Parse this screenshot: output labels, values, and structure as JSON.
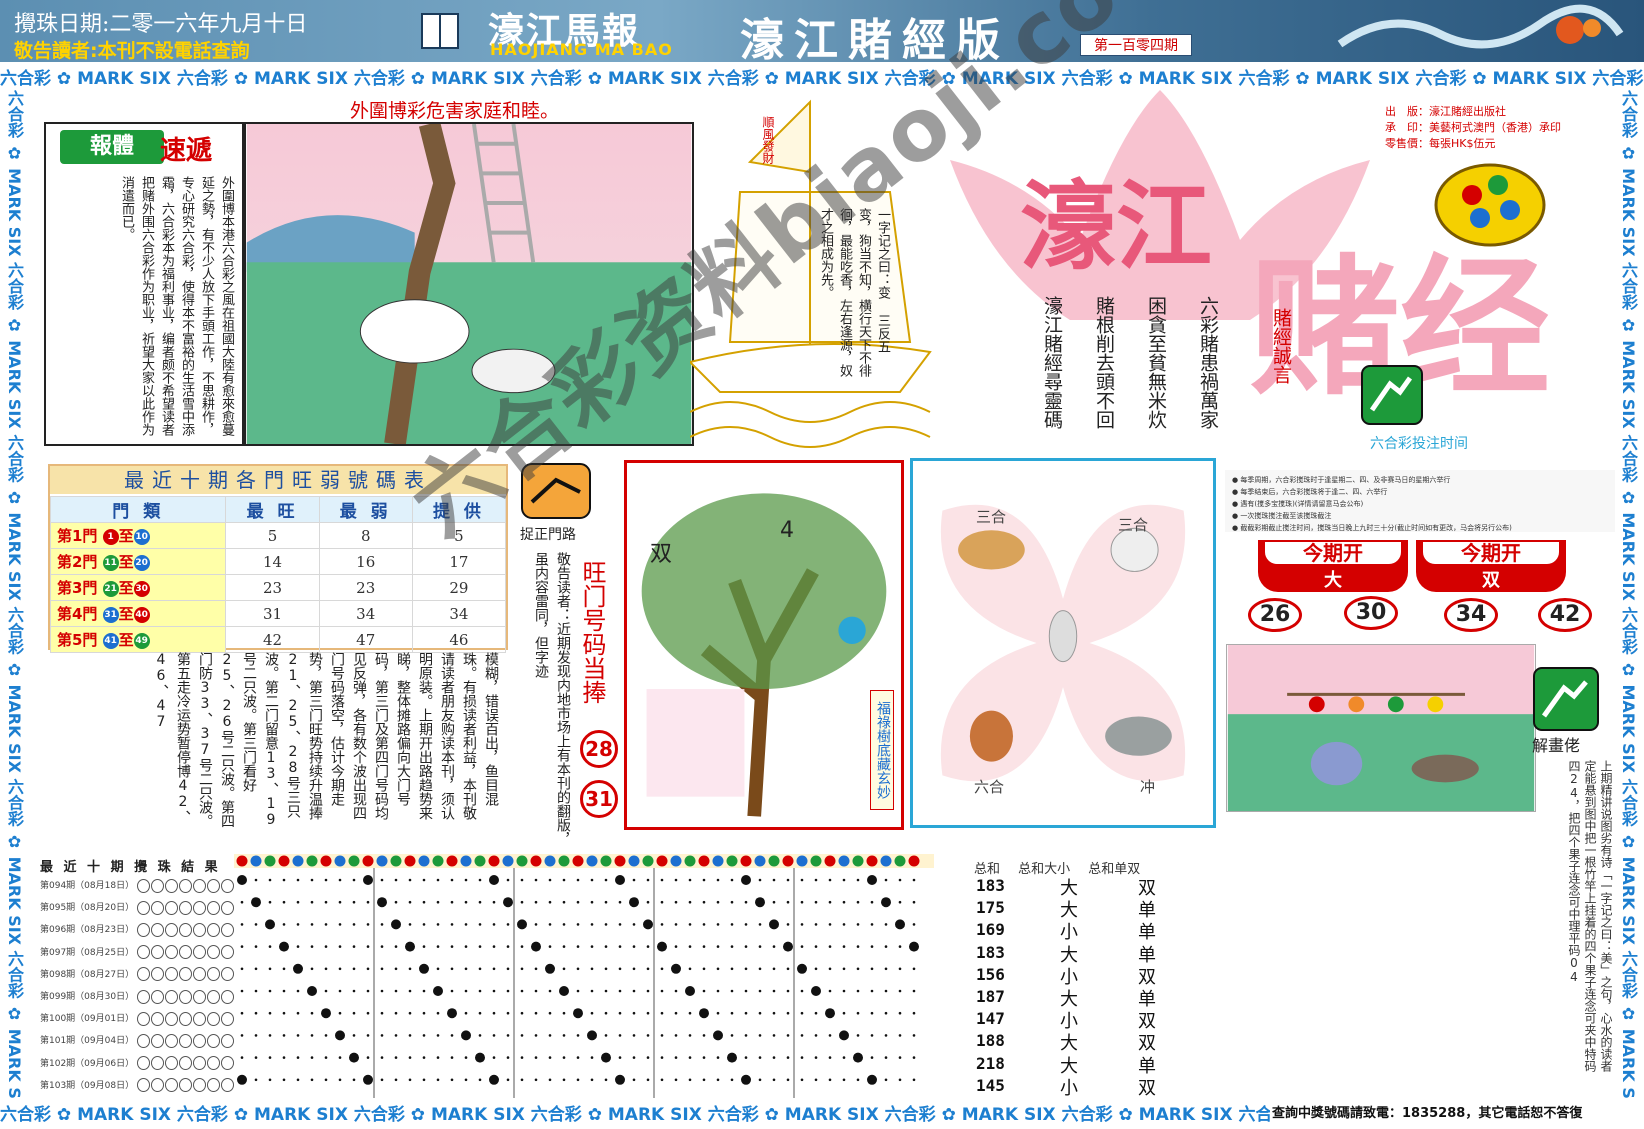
{
  "header": {
    "date": "攪珠日期:二零一六年九月十日",
    "notice": "敬告讀者:本刊不設電話查詢",
    "logo_cn": "濠江馬報",
    "logo_en": "HAOJIANG MA BAO",
    "edition": "濠江賭經版",
    "issue": "第一百零四期"
  },
  "border_text": "六合彩 ✿ MARK SIX 六合彩 ✿ MARK SIX 六合彩 ✿ MARK SIX 六合彩 ✿ MARK SIX 六合彩 ✿ MARK SIX 六合彩 ✿ MARK SIX 六合彩 ✿ MARK SIX 六合彩 ✿ MARK SIX 六合彩 ✿ MARK SIX 六合彩 ✿ MARK SIX",
  "headline": "外圍博彩危害家庭和睦。",
  "article": {
    "tag": "報體",
    "tag2": "速遞",
    "text": "外圍博本港六合彩之風在祖國大陸有愈來愈蔓延之勢，有不少人放下手頭工作，不思耕作，专心研究六合彩，使得本不富裕的生活雪中添霜，六合彩本为福利事业，编者颇不希望读者把赌外围六合彩作为职业，祈望大家以此作为消遣而已。"
  },
  "ship": {
    "flag": "順風發財",
    "text": "一字记之曰：变 三反五变，狗当不知，横行天下不徘徊，最能吃香，左右逢源，奴才之相成为先。"
  },
  "title_block": {
    "big1": "濠江",
    "big2": "赌经",
    "publisher": "出　版：濠江賭經出版社",
    "printer": "承　印：美藝柯式澳門（香港）承印",
    "price": "零售價：每張HK$伍元",
    "slogans": [
      "六彩賭患禍萬家",
      "困貪至貧無米炊",
      "賭根削去頭不回",
      "濠江賭經尋靈碼"
    ],
    "motto": "賭經誠言",
    "bet_time_title": "六合彩投注时间"
  },
  "stats": {
    "title": "最近十期各門旺弱號碼表",
    "headers": [
      "門 類",
      "最 旺",
      "最 弱",
      "提 供"
    ],
    "rows": [
      {
        "door": "第1門",
        "from": "1",
        "to": "10",
        "hot": "5",
        "cold": "8",
        "tip": "5",
        "c1": "#d40000",
        "c2": "#1d6fd0"
      },
      {
        "door": "第2門",
        "from": "11",
        "to": "20",
        "hot": "14",
        "cold": "16",
        "tip": "17",
        "c1": "#1d9a3a",
        "c2": "#1d6fd0"
      },
      {
        "door": "第3門",
        "from": "21",
        "to": "30",
        "hot": "23",
        "cold": "23",
        "tip": "29",
        "c1": "#1d9a3a",
        "c2": "#d40000"
      },
      {
        "door": "第4門",
        "from": "31",
        "to": "40",
        "hot": "31",
        "cold": "34",
        "tip": "34",
        "c1": "#1d6fd0",
        "c2": "#d40000"
      },
      {
        "door": "第5門",
        "from": "41",
        "to": "49",
        "hot": "42",
        "cold": "47",
        "tip": "46",
        "c1": "#1d6fd0",
        "c2": "#1d9a3a"
      }
    ],
    "zhi": "至"
  },
  "mid": {
    "zheng_label": "捉正門路",
    "text": "模糊，错误百出，鱼目混珠。有损读者利益，本刊敬请读者朋友购读本刊，须认明原装。上期开出路趋势来睇，整体摊路偏向大门号码，第三门及第四门号码均见反弹，各有数个波出现四门号码落空，估计今期走势，第三门旺势持续升温捧21、25、28号三只波。第二门留意13、19号二只波。第三门看好25、26号二只波。第四门防33、37号二只波。第五走冷运势暂停博42、46、47",
    "text2": "敬告读者：近期发现内地市场上有本刊的翻版，虽内容雷同，但字迹",
    "hot_title": "旺门号码当捧",
    "hot_balls": [
      "28",
      "31"
    ]
  },
  "tree": {
    "label_double": "双",
    "label_4": "4",
    "side_text": "福祿樹底藏玄妙"
  },
  "zodiac": {
    "tl": "三合",
    "tr": "三合",
    "bl": "六合",
    "br": "冲"
  },
  "bet_info": {
    "lines": [
      "● 每季周期，六合彩搅珠时于逢星期二、四、及非赛马日的星期六举行",
      "● 每季结束后，六合彩搅珠将于逢二、四、六举行",
      "● 遇有(搅多宝搅珠)(详情请留意马会公布)",
      "● 一次搅珠搅注截至该搅珠截注",
      "● 截截彩期截止搅注时间，搅珠当日晚上九时三十分(截止时间如有更改，马会将另行公布)"
    ],
    "open_label": "今期开",
    "open_values": [
      "大",
      "双"
    ],
    "numbers": [
      "26",
      "30",
      "34",
      "42"
    ]
  },
  "riddle": {
    "label": "解畫佬",
    "text": "上期精讲说图劣有诗「一字记之曰：美」之句，心水的读者定能悬到图中把一根竹竿上挂着的四个果子连念可夹中特码四24，把四个果子连念可中理平码04"
  },
  "results": {
    "title": "最 近 十 期 攪 珠 結 果",
    "rows": [
      {
        "issue": "第094期（08月18日）",
        "sum": "183",
        "bs": "大",
        "oe": "双"
      },
      {
        "issue": "第095期（08月20日）",
        "sum": "175",
        "bs": "大",
        "oe": "单"
      },
      {
        "issue": "第096期（08月23日）",
        "sum": "169",
        "bs": "小",
        "oe": "单"
      },
      {
        "issue": "第097期（08月25日）",
        "sum": "183",
        "bs": "大",
        "oe": "单"
      },
      {
        "issue": "第098期（08月27日）",
        "sum": "156",
        "bs": "小",
        "oe": "双"
      },
      {
        "issue": "第099期（08月30日）",
        "sum": "187",
        "bs": "大",
        "oe": "单"
      },
      {
        "issue": "第100期（09月01日）",
        "sum": "147",
        "bs": "小",
        "oe": "双"
      },
      {
        "issue": "第101期（09月04日）",
        "sum": "188",
        "bs": "大",
        "oe": "双"
      },
      {
        "issue": "第102期（09月06日）",
        "sum": "218",
        "bs": "大",
        "oe": "单"
      },
      {
        "issue": "第103期（09月08日）",
        "sum": "145",
        "bs": "小",
        "oe": "双"
      }
    ],
    "sum_headers": "总和 总和大小 总和单双"
  },
  "footer": {
    "query": "查詢中獎號碼請致電：1835288，其它電話恕不答復"
  },
  "watermark": "六合彩资料biaoji.com"
}
